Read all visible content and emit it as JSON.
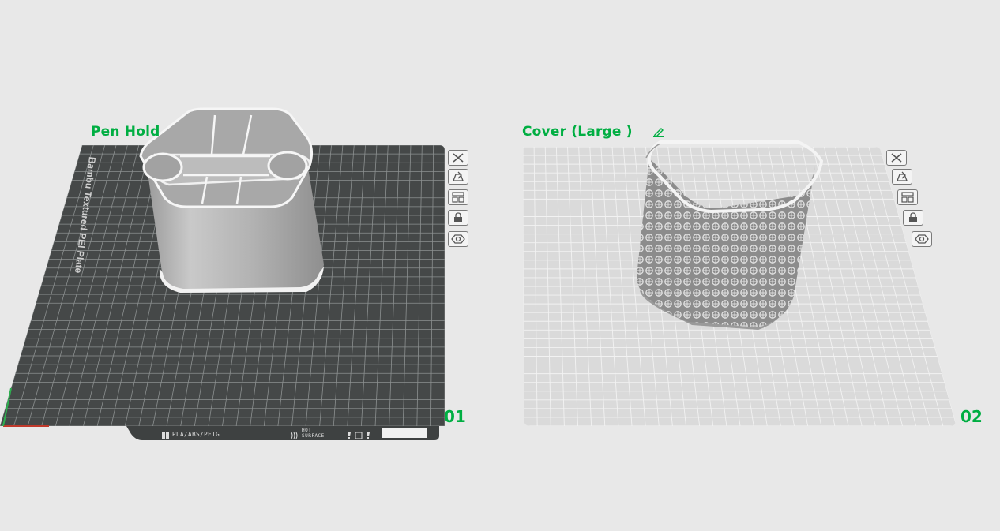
{
  "plates": [
    {
      "number": "01",
      "title": "Pen Hold",
      "bed_name": "Bambu Textured PEI Plate",
      "filament_label": "PLA/ABS/PETG",
      "surface_label_1": "HOT",
      "surface_label_2": "SURFACE",
      "active": true
    },
    {
      "number": "02",
      "title": "Cover (Large )",
      "active": false
    }
  ],
  "plate_toolbar": [
    {
      "name": "close-plate",
      "icon": "close-icon"
    },
    {
      "name": "auto-orient",
      "icon": "orient-icon"
    },
    {
      "name": "arrange",
      "icon": "arrange-icon"
    },
    {
      "name": "lock-plate",
      "icon": "lock-icon"
    },
    {
      "name": "plate-settings",
      "icon": "settings-icon"
    }
  ],
  "colors": {
    "accent": "#00ae42",
    "background": "#e8e8e8",
    "active_bed": "#454848",
    "inactive_bed": "#d9d9d9",
    "model": "#b5b5b5"
  }
}
